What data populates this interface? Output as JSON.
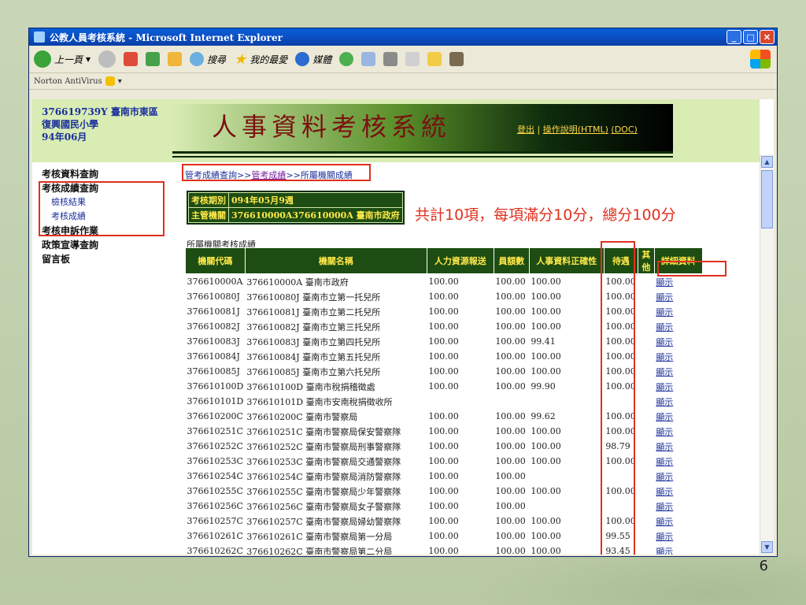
{
  "window": {
    "title": "公教人員考核系統 - Microsoft Internet Explorer",
    "controls": [
      "_",
      "□",
      "✕"
    ]
  },
  "toolbar": {
    "back": "上一頁",
    "search": "搜尋",
    "favorites": "我的最愛",
    "media": "媒體"
  },
  "norton": {
    "label": "Norton AntiVirus"
  },
  "school": {
    "line1": "376619739Y 臺南市東區",
    "line2": "復興國民小學",
    "line3": "94年06月"
  },
  "banner": {
    "title": "人事資料考核系統",
    "logout": "登出",
    "help": "操作說明(HTML)",
    "doc": "(DOC)",
    "sep": "|"
  },
  "sidebar": {
    "items": [
      {
        "label": "考核資料查詢"
      },
      {
        "label": "考核成績查詢"
      },
      {
        "label": "檢核結果"
      },
      {
        "label": "考核成績"
      },
      {
        "label": "考核申訴作業"
      },
      {
        "label": "政策宣導查詢"
      },
      {
        "label": "留言板"
      }
    ]
  },
  "breadcrumb": {
    "part1": "管考成績查詢>>",
    "part2": "管考成績",
    "part3": ">>所屬機關成績"
  },
  "info": {
    "period_label": "考核期別",
    "period_value": "094年05月9週",
    "agency_label": "主管機關",
    "agency_value": "376610000A376610000A 臺南市政府"
  },
  "summary": "共計10項，每項滿分10分，總分100分",
  "table": {
    "title": "所屬機關考核成績",
    "headers": [
      "機關代碼",
      "機關名稱",
      "人力資源報送",
      "員額數",
      "人事資料正確性",
      "待遇",
      "其他",
      "詳細資料"
    ],
    "rows": [
      [
        "376610000A",
        "376610000A 臺南市政府",
        "100.00",
        "100.00",
        "100.00",
        "100.00",
        "",
        "顯示"
      ],
      [
        "376610080J",
        "376610080J 臺南市立第一托兒所",
        "100.00",
        "100.00",
        "100.00",
        "100.00",
        "",
        "顯示"
      ],
      [
        "376610081J",
        "376610081J 臺南市立第二托兒所",
        "100.00",
        "100.00",
        "100.00",
        "100.00",
        "",
        "顯示"
      ],
      [
        "376610082J",
        "376610082J 臺南市立第三托兒所",
        "100.00",
        "100.00",
        "100.00",
        "100.00",
        "",
        "顯示"
      ],
      [
        "376610083J",
        "376610083J 臺南市立第四托兒所",
        "100.00",
        "100.00",
        "99.41",
        "100.00",
        "",
        "顯示"
      ],
      [
        "376610084J",
        "376610084J 臺南市立第五托兒所",
        "100.00",
        "100.00",
        "100.00",
        "100.00",
        "",
        "顯示"
      ],
      [
        "376610085J",
        "376610085J 臺南市立第六托兒所",
        "100.00",
        "100.00",
        "100.00",
        "100.00",
        "",
        "顯示"
      ],
      [
        "376610100D",
        "376610100D 臺南市稅捐稽徵處",
        "100.00",
        "100.00",
        "99.90",
        "100.00",
        "",
        "顯示"
      ],
      [
        "376610101D",
        "376610101D 臺南市安南稅捐徵收所",
        "",
        "",
        "",
        "",
        "",
        "顯示"
      ],
      [
        "376610200C",
        "376610200C 臺南市警察局",
        "100.00",
        "100.00",
        "99.62",
        "100.00",
        "",
        "顯示"
      ],
      [
        "376610251C",
        "376610251C 臺南市警察局保安警察隊",
        "100.00",
        "100.00",
        "100.00",
        "100.00",
        "",
        "顯示"
      ],
      [
        "376610252C",
        "376610252C 臺南市警察局刑事警察隊",
        "100.00",
        "100.00",
        "100.00",
        "98.79",
        "",
        "顯示"
      ],
      [
        "376610253C",
        "376610253C 臺南市警察局交通警察隊",
        "100.00",
        "100.00",
        "100.00",
        "100.00",
        "",
        "顯示"
      ],
      [
        "376610254C",
        "376610254C 臺南市警察局消防警察隊",
        "100.00",
        "100.00",
        "",
        "",
        "",
        "顯示"
      ],
      [
        "376610255C",
        "376610255C 臺南市警察局少年警察隊",
        "100.00",
        "100.00",
        "100.00",
        "100.00",
        "",
        "顯示"
      ],
      [
        "376610256C",
        "376610256C 臺南市警察局女子警察隊",
        "100.00",
        "100.00",
        "",
        "",
        "",
        "顯示"
      ],
      [
        "376610257C",
        "376610257C 臺南市警察局婦幼警察隊",
        "100.00",
        "100.00",
        "100.00",
        "100.00",
        "",
        "顯示"
      ],
      [
        "376610261C",
        "376610261C 臺南市警察局第一分局",
        "100.00",
        "100.00",
        "100.00",
        "99.55",
        "",
        "顯示"
      ],
      [
        "376610262C",
        "376610262C 臺南市警察局第二分局",
        "100.00",
        "100.00",
        "100.00",
        "93.45",
        "",
        "顯示"
      ]
    ]
  },
  "slide": {
    "page_number": "6"
  },
  "colors": {
    "header_green": "#1d4d12",
    "header_text": "#ffe94a",
    "highlight_red": "#e0301e"
  }
}
